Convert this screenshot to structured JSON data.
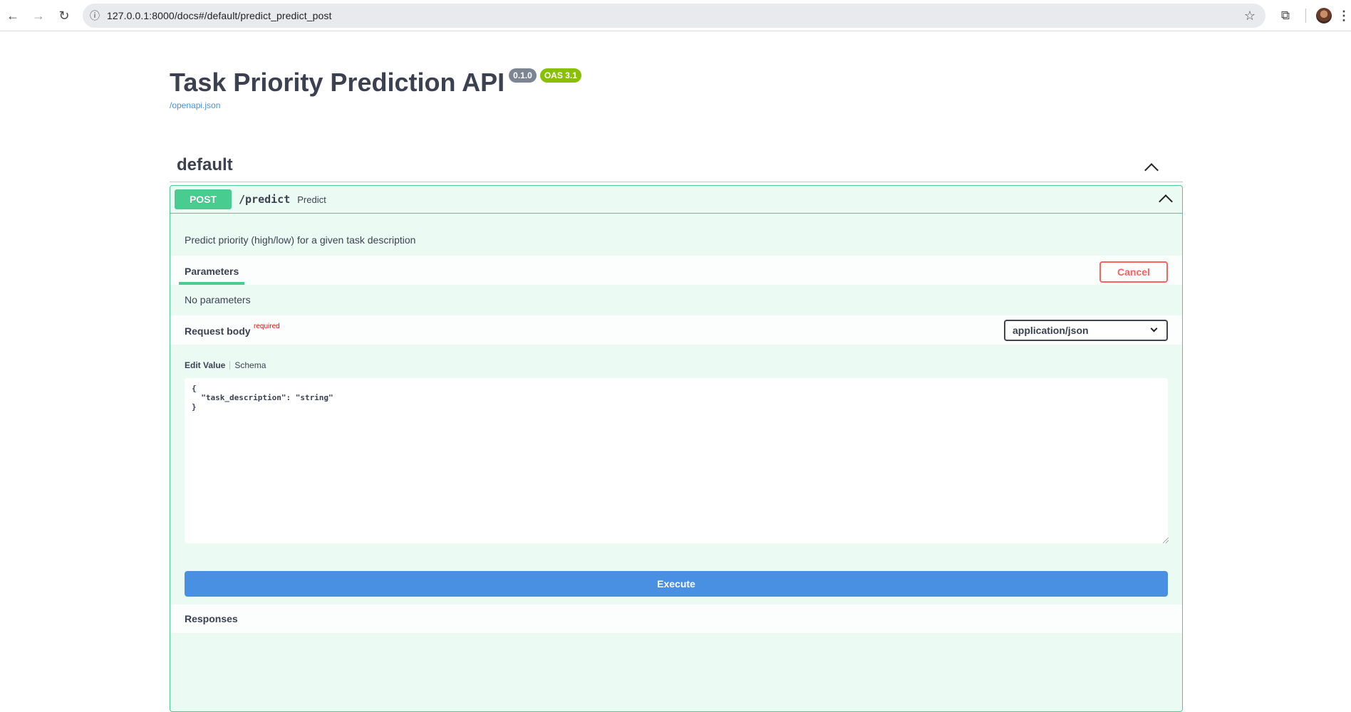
{
  "browser": {
    "url": "127.0.0.1:8000/docs#/default/predict_predict_post",
    "back_icon": "←",
    "forward_icon": "→",
    "reload_icon": "↻",
    "info_icon": "ⓘ",
    "star_icon": "☆",
    "extensions_icon": "⧉",
    "menu_icon": "⋮"
  },
  "api": {
    "title": "Task Priority Prediction API",
    "version": "0.1.0",
    "oas_version": "OAS 3.1",
    "spec_link": "/openapi.json"
  },
  "section": {
    "name": "default"
  },
  "operation": {
    "method": "POST",
    "path": "/predict",
    "summary": "Predict",
    "description": "Predict priority (high/low) for a given task description",
    "parameters_tab": "Parameters",
    "cancel_label": "Cancel",
    "no_parameters": "No parameters",
    "request_body_label": "Request body",
    "required_label": "required",
    "content_type": "application/json",
    "edit_value_tab": "Edit Value",
    "schema_tab": "Schema",
    "body_value": "{\n  \"task_description\": \"string\"\n}",
    "execute_label": "Execute",
    "responses_label": "Responses"
  },
  "colors": {
    "post_green": "#49cc90",
    "execute_blue": "#4990e2",
    "cancel_red": "#ff6060",
    "version_badge": "#7d8492",
    "oas_badge": "#89bf04"
  }
}
